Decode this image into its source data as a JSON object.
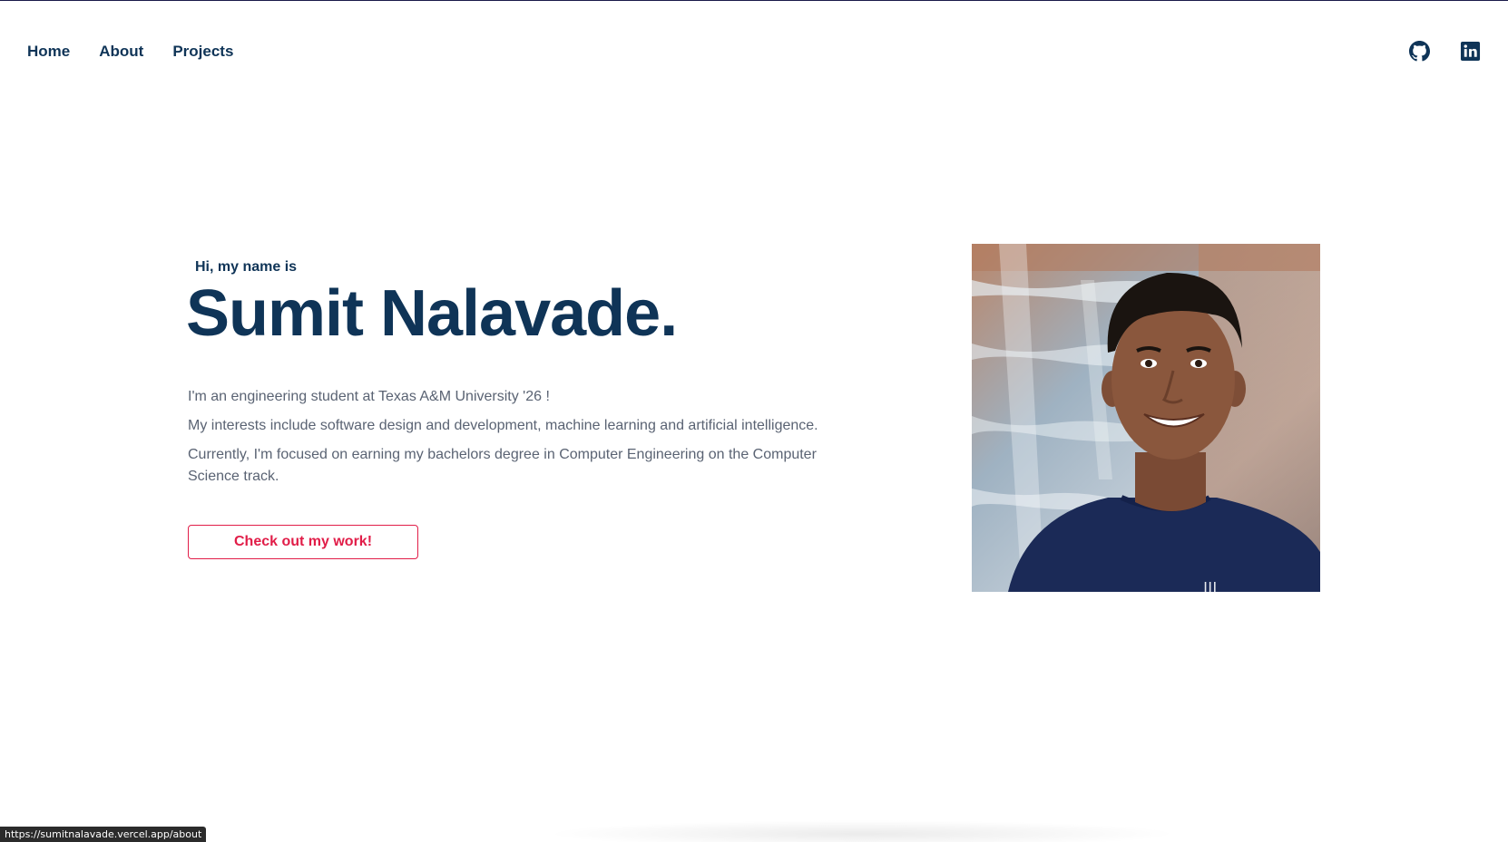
{
  "nav": {
    "items": [
      {
        "label": "Home"
      },
      {
        "label": "About"
      },
      {
        "label": "Projects"
      }
    ]
  },
  "social": {
    "github_icon": "github-icon",
    "linkedin_icon": "linkedin-icon"
  },
  "hero": {
    "greeting": "Hi, my name is",
    "name": "Sumit Nalavade.",
    "bio": [
      "I'm an engineering student at Texas A&M University '26 !",
      "My interests include software design and development, machine learning and artificial intelligence.",
      "Currently, I'm focused on earning my bachelors degree in Computer Engineering on the Computer Science track."
    ],
    "cta_label": "Check out my work!"
  },
  "status_bar": {
    "url": "https://sumitnalavade.vercel.app/about"
  },
  "colors": {
    "primary": "#0f3457",
    "accent": "#e11d48",
    "body_text": "#5a6373"
  }
}
